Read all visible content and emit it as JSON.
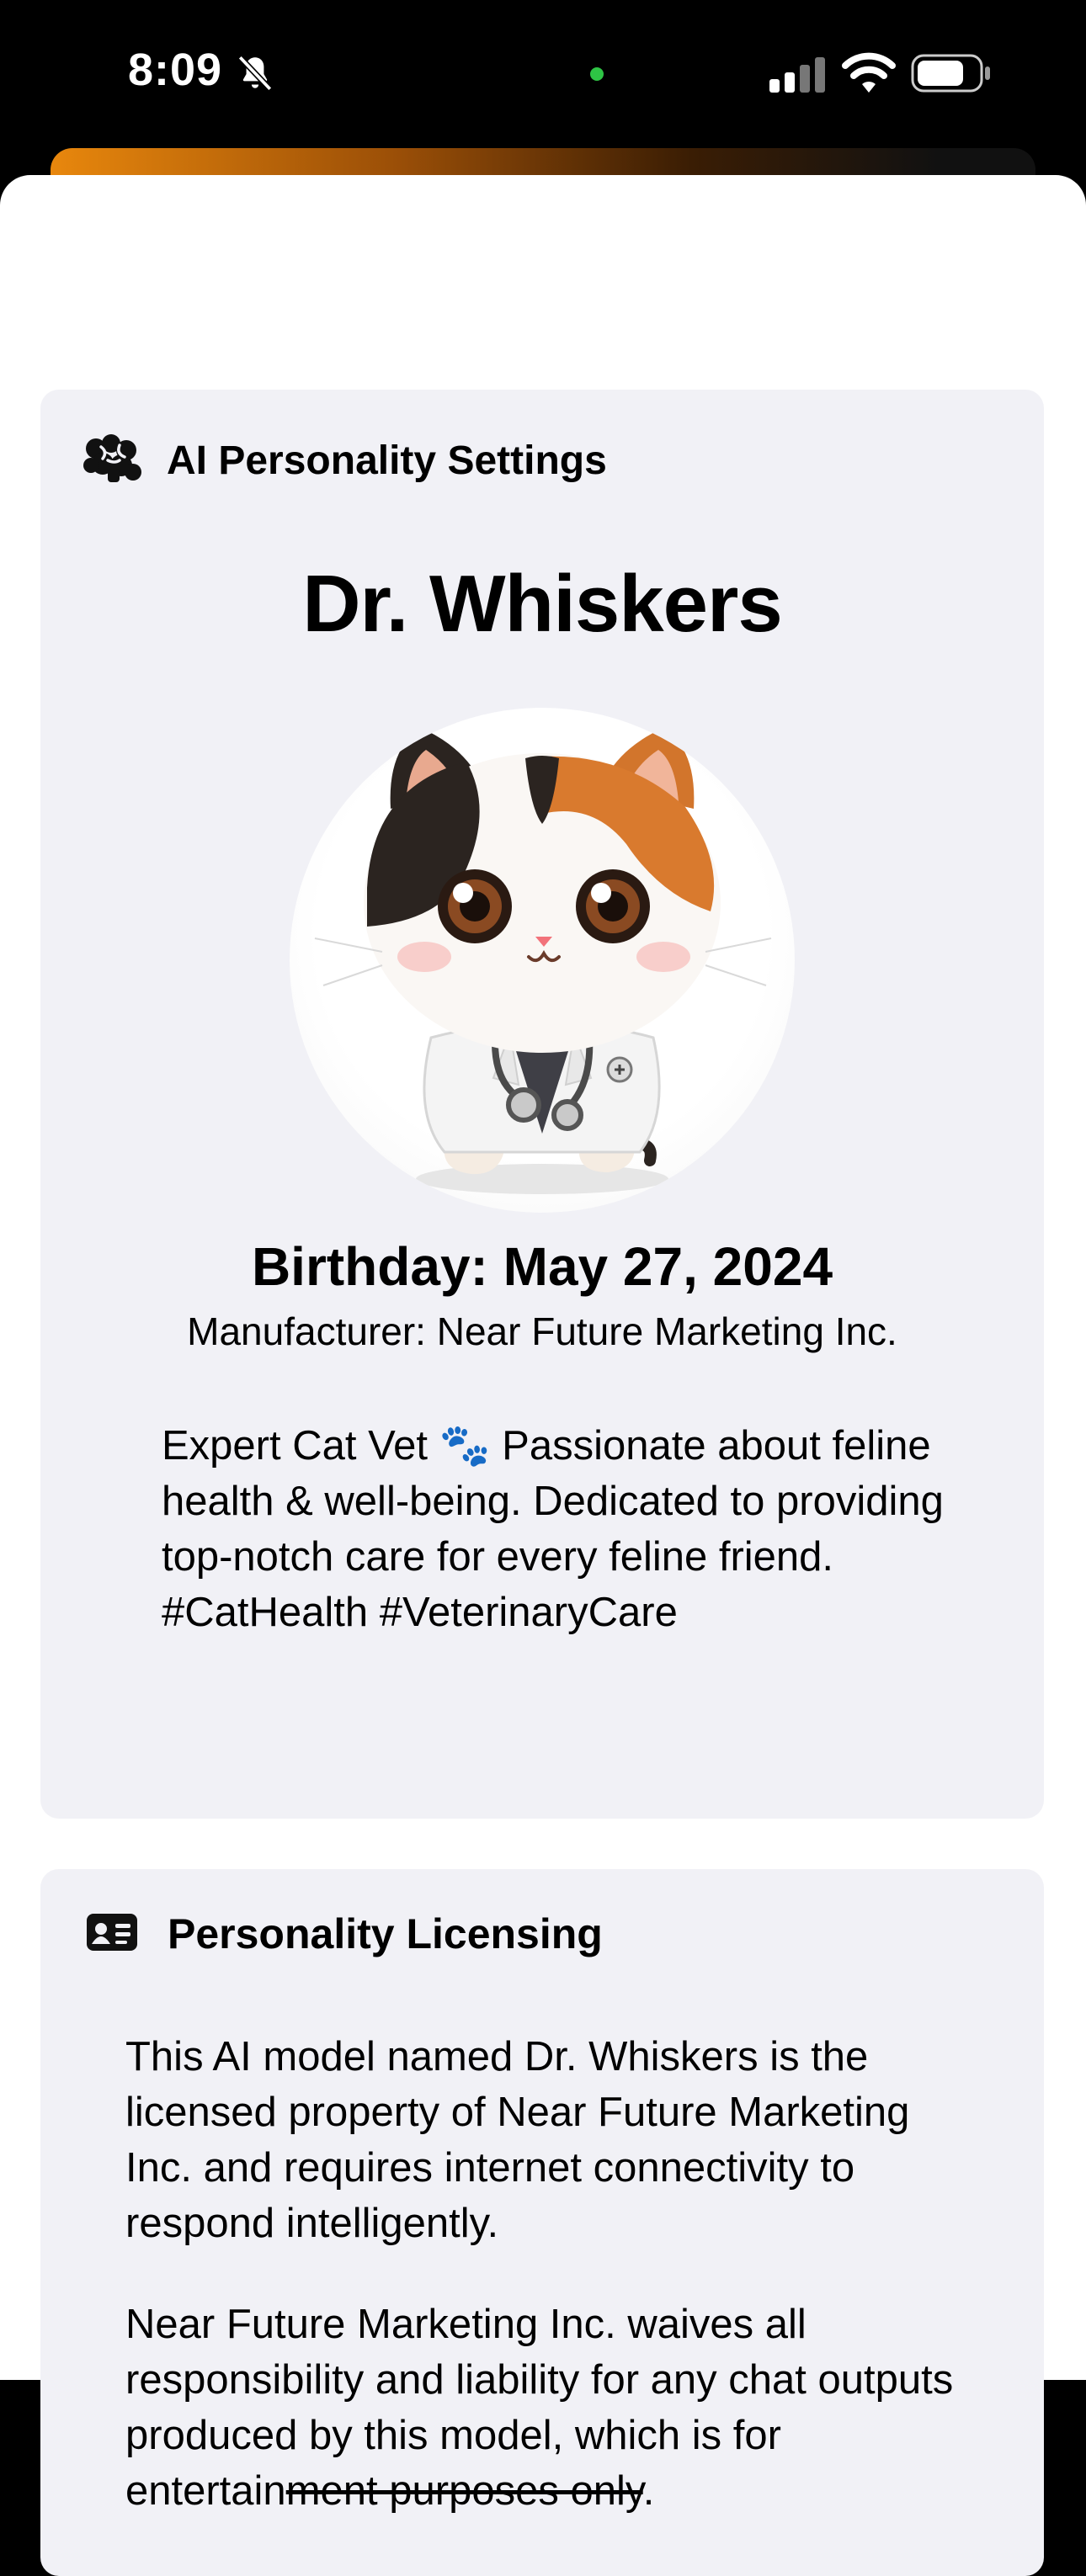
{
  "status_bar": {
    "time": "8:09",
    "icons": [
      "bell-slash-icon",
      "camera-indicator-dot",
      "signal-icon",
      "wifi-icon",
      "battery-icon"
    ]
  },
  "personality_card": {
    "header_icon": "brain-icon",
    "header_label": "AI Personality Settings",
    "name": "Dr. Whiskers",
    "avatar_desc": "calico-cat-vet-avatar",
    "birthday": "Birthday: May 27, 2024",
    "manufacturer": "Manufacturer: Near Future Marketing Inc.",
    "bio": "Expert Cat Vet 🐾 Passionate about feline health & well-being. Dedicated to providing top-notch care for every feline friend. #CatHealth #VeterinaryCare"
  },
  "licensing_card": {
    "header_icon": "id-card-icon",
    "header_label": "Personality Licensing",
    "paragraph1": "This AI model named Dr. Whiskers is the licensed property of Near Future Marketing Inc. and requires internet connectivity to respond intelligently.",
    "paragraph2_start": "Near Future Marketing Inc. waives all responsibility and liability for any chat outputs produced by this model, which is for entertain",
    "paragraph2_struck": "ment purposes only",
    "paragraph2_end": "."
  },
  "colors": {
    "card_bg": "#f1f1f6",
    "sheet_peek_orange": "#e8870d",
    "camera_indicator": "#2ec445"
  }
}
